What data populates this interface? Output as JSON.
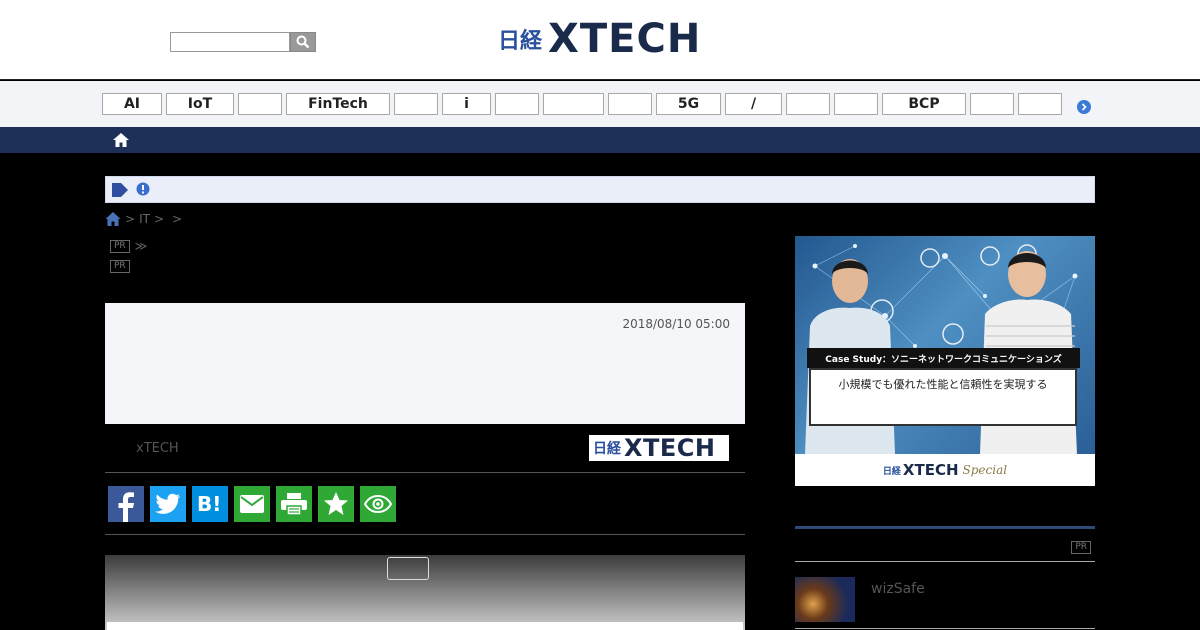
{
  "header": {
    "search": {
      "value": "",
      "placeholder": ""
    },
    "logo": {
      "jp": "日経",
      "x": "XTECH"
    }
  },
  "tagbar": {
    "tags": [
      {
        "label": "AI"
      },
      {
        "label": "IoT"
      },
      {
        "label": ""
      },
      {
        "label": "FinTech"
      },
      {
        "label": ""
      },
      {
        "label": "i"
      },
      {
        "label": ""
      },
      {
        "label": ""
      },
      {
        "label": ""
      },
      {
        "label": "5G"
      },
      {
        "label": "/"
      },
      {
        "label": ""
      },
      {
        "label": ""
      },
      {
        "label": "BCP"
      },
      {
        "label": ""
      },
      {
        "label": ""
      }
    ]
  },
  "notice": {
    "text": ""
  },
  "breadcrumb": {
    "items": [
      "",
      "IT",
      ""
    ],
    "sep": ">"
  },
  "pr_lines": [
    {
      "badge": "PR",
      "suffix": "≫"
    },
    {
      "badge": "PR",
      "suffix": ""
    }
  ],
  "article": {
    "date": "2018/08/10 05:00",
    "source_name": "xTECH",
    "source_logo": {
      "jp": "日経",
      "x": "XTECH"
    }
  },
  "share_buttons": [
    {
      "icon": "facebook-icon",
      "color": "#3b5998"
    },
    {
      "icon": "twitter-icon",
      "color": "#1da1f2"
    },
    {
      "icon": "hatena-bookmark-icon",
      "color": "#008fde"
    },
    {
      "icon": "mail-icon",
      "color": "#2fa835"
    },
    {
      "icon": "print-icon",
      "color": "#2fa835"
    },
    {
      "icon": "star-icon",
      "color": "#2fa835"
    },
    {
      "icon": "eye-icon",
      "color": "#2fa835"
    }
  ],
  "sidebar": {
    "ad": {
      "case_label": "Case Study：ソニーネットワークコミュニケーションズ",
      "subtitle": "小規模でも優れた性能と信頼性を実現する",
      "footer": {
        "jp": "日経",
        "x": "XTECH",
        "special": "Special"
      }
    },
    "pr_section": {
      "badge": "PR"
    },
    "items": [
      {
        "title": "wizSafe"
      }
    ]
  }
}
